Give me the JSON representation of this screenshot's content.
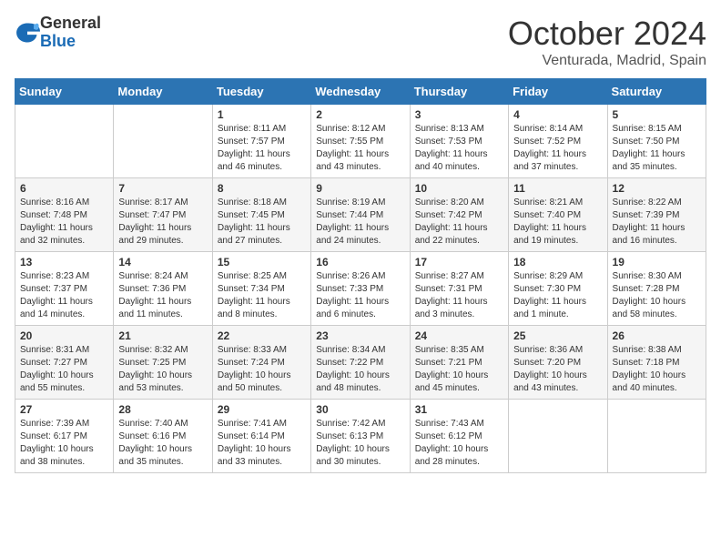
{
  "header": {
    "logo_general": "General",
    "logo_blue": "Blue",
    "month": "October 2024",
    "location": "Venturada, Madrid, Spain"
  },
  "weekdays": [
    "Sunday",
    "Monday",
    "Tuesday",
    "Wednesday",
    "Thursday",
    "Friday",
    "Saturday"
  ],
  "weeks": [
    [
      {
        "day": "",
        "sunrise": "",
        "sunset": "",
        "daylight": ""
      },
      {
        "day": "",
        "sunrise": "",
        "sunset": "",
        "daylight": ""
      },
      {
        "day": "1",
        "sunrise": "Sunrise: 8:11 AM",
        "sunset": "Sunset: 7:57 PM",
        "daylight": "Daylight: 11 hours and 46 minutes."
      },
      {
        "day": "2",
        "sunrise": "Sunrise: 8:12 AM",
        "sunset": "Sunset: 7:55 PM",
        "daylight": "Daylight: 11 hours and 43 minutes."
      },
      {
        "day": "3",
        "sunrise": "Sunrise: 8:13 AM",
        "sunset": "Sunset: 7:53 PM",
        "daylight": "Daylight: 11 hours and 40 minutes."
      },
      {
        "day": "4",
        "sunrise": "Sunrise: 8:14 AM",
        "sunset": "Sunset: 7:52 PM",
        "daylight": "Daylight: 11 hours and 37 minutes."
      },
      {
        "day": "5",
        "sunrise": "Sunrise: 8:15 AM",
        "sunset": "Sunset: 7:50 PM",
        "daylight": "Daylight: 11 hours and 35 minutes."
      }
    ],
    [
      {
        "day": "6",
        "sunrise": "Sunrise: 8:16 AM",
        "sunset": "Sunset: 7:48 PM",
        "daylight": "Daylight: 11 hours and 32 minutes."
      },
      {
        "day": "7",
        "sunrise": "Sunrise: 8:17 AM",
        "sunset": "Sunset: 7:47 PM",
        "daylight": "Daylight: 11 hours and 29 minutes."
      },
      {
        "day": "8",
        "sunrise": "Sunrise: 8:18 AM",
        "sunset": "Sunset: 7:45 PM",
        "daylight": "Daylight: 11 hours and 27 minutes."
      },
      {
        "day": "9",
        "sunrise": "Sunrise: 8:19 AM",
        "sunset": "Sunset: 7:44 PM",
        "daylight": "Daylight: 11 hours and 24 minutes."
      },
      {
        "day": "10",
        "sunrise": "Sunrise: 8:20 AM",
        "sunset": "Sunset: 7:42 PM",
        "daylight": "Daylight: 11 hours and 22 minutes."
      },
      {
        "day": "11",
        "sunrise": "Sunrise: 8:21 AM",
        "sunset": "Sunset: 7:40 PM",
        "daylight": "Daylight: 11 hours and 19 minutes."
      },
      {
        "day": "12",
        "sunrise": "Sunrise: 8:22 AM",
        "sunset": "Sunset: 7:39 PM",
        "daylight": "Daylight: 11 hours and 16 minutes."
      }
    ],
    [
      {
        "day": "13",
        "sunrise": "Sunrise: 8:23 AM",
        "sunset": "Sunset: 7:37 PM",
        "daylight": "Daylight: 11 hours and 14 minutes."
      },
      {
        "day": "14",
        "sunrise": "Sunrise: 8:24 AM",
        "sunset": "Sunset: 7:36 PM",
        "daylight": "Daylight: 11 hours and 11 minutes."
      },
      {
        "day": "15",
        "sunrise": "Sunrise: 8:25 AM",
        "sunset": "Sunset: 7:34 PM",
        "daylight": "Daylight: 11 hours and 8 minutes."
      },
      {
        "day": "16",
        "sunrise": "Sunrise: 8:26 AM",
        "sunset": "Sunset: 7:33 PM",
        "daylight": "Daylight: 11 hours and 6 minutes."
      },
      {
        "day": "17",
        "sunrise": "Sunrise: 8:27 AM",
        "sunset": "Sunset: 7:31 PM",
        "daylight": "Daylight: 11 hours and 3 minutes."
      },
      {
        "day": "18",
        "sunrise": "Sunrise: 8:29 AM",
        "sunset": "Sunset: 7:30 PM",
        "daylight": "Daylight: 11 hours and 1 minute."
      },
      {
        "day": "19",
        "sunrise": "Sunrise: 8:30 AM",
        "sunset": "Sunset: 7:28 PM",
        "daylight": "Daylight: 10 hours and 58 minutes."
      }
    ],
    [
      {
        "day": "20",
        "sunrise": "Sunrise: 8:31 AM",
        "sunset": "Sunset: 7:27 PM",
        "daylight": "Daylight: 10 hours and 55 minutes."
      },
      {
        "day": "21",
        "sunrise": "Sunrise: 8:32 AM",
        "sunset": "Sunset: 7:25 PM",
        "daylight": "Daylight: 10 hours and 53 minutes."
      },
      {
        "day": "22",
        "sunrise": "Sunrise: 8:33 AM",
        "sunset": "Sunset: 7:24 PM",
        "daylight": "Daylight: 10 hours and 50 minutes."
      },
      {
        "day": "23",
        "sunrise": "Sunrise: 8:34 AM",
        "sunset": "Sunset: 7:22 PM",
        "daylight": "Daylight: 10 hours and 48 minutes."
      },
      {
        "day": "24",
        "sunrise": "Sunrise: 8:35 AM",
        "sunset": "Sunset: 7:21 PM",
        "daylight": "Daylight: 10 hours and 45 minutes."
      },
      {
        "day": "25",
        "sunrise": "Sunrise: 8:36 AM",
        "sunset": "Sunset: 7:20 PM",
        "daylight": "Daylight: 10 hours and 43 minutes."
      },
      {
        "day": "26",
        "sunrise": "Sunrise: 8:38 AM",
        "sunset": "Sunset: 7:18 PM",
        "daylight": "Daylight: 10 hours and 40 minutes."
      }
    ],
    [
      {
        "day": "27",
        "sunrise": "Sunrise: 7:39 AM",
        "sunset": "Sunset: 6:17 PM",
        "daylight": "Daylight: 10 hours and 38 minutes."
      },
      {
        "day": "28",
        "sunrise": "Sunrise: 7:40 AM",
        "sunset": "Sunset: 6:16 PM",
        "daylight": "Daylight: 10 hours and 35 minutes."
      },
      {
        "day": "29",
        "sunrise": "Sunrise: 7:41 AM",
        "sunset": "Sunset: 6:14 PM",
        "daylight": "Daylight: 10 hours and 33 minutes."
      },
      {
        "day": "30",
        "sunrise": "Sunrise: 7:42 AM",
        "sunset": "Sunset: 6:13 PM",
        "daylight": "Daylight: 10 hours and 30 minutes."
      },
      {
        "day": "31",
        "sunrise": "Sunrise: 7:43 AM",
        "sunset": "Sunset: 6:12 PM",
        "daylight": "Daylight: 10 hours and 28 minutes."
      },
      {
        "day": "",
        "sunrise": "",
        "sunset": "",
        "daylight": ""
      },
      {
        "day": "",
        "sunrise": "",
        "sunset": "",
        "daylight": ""
      }
    ]
  ]
}
